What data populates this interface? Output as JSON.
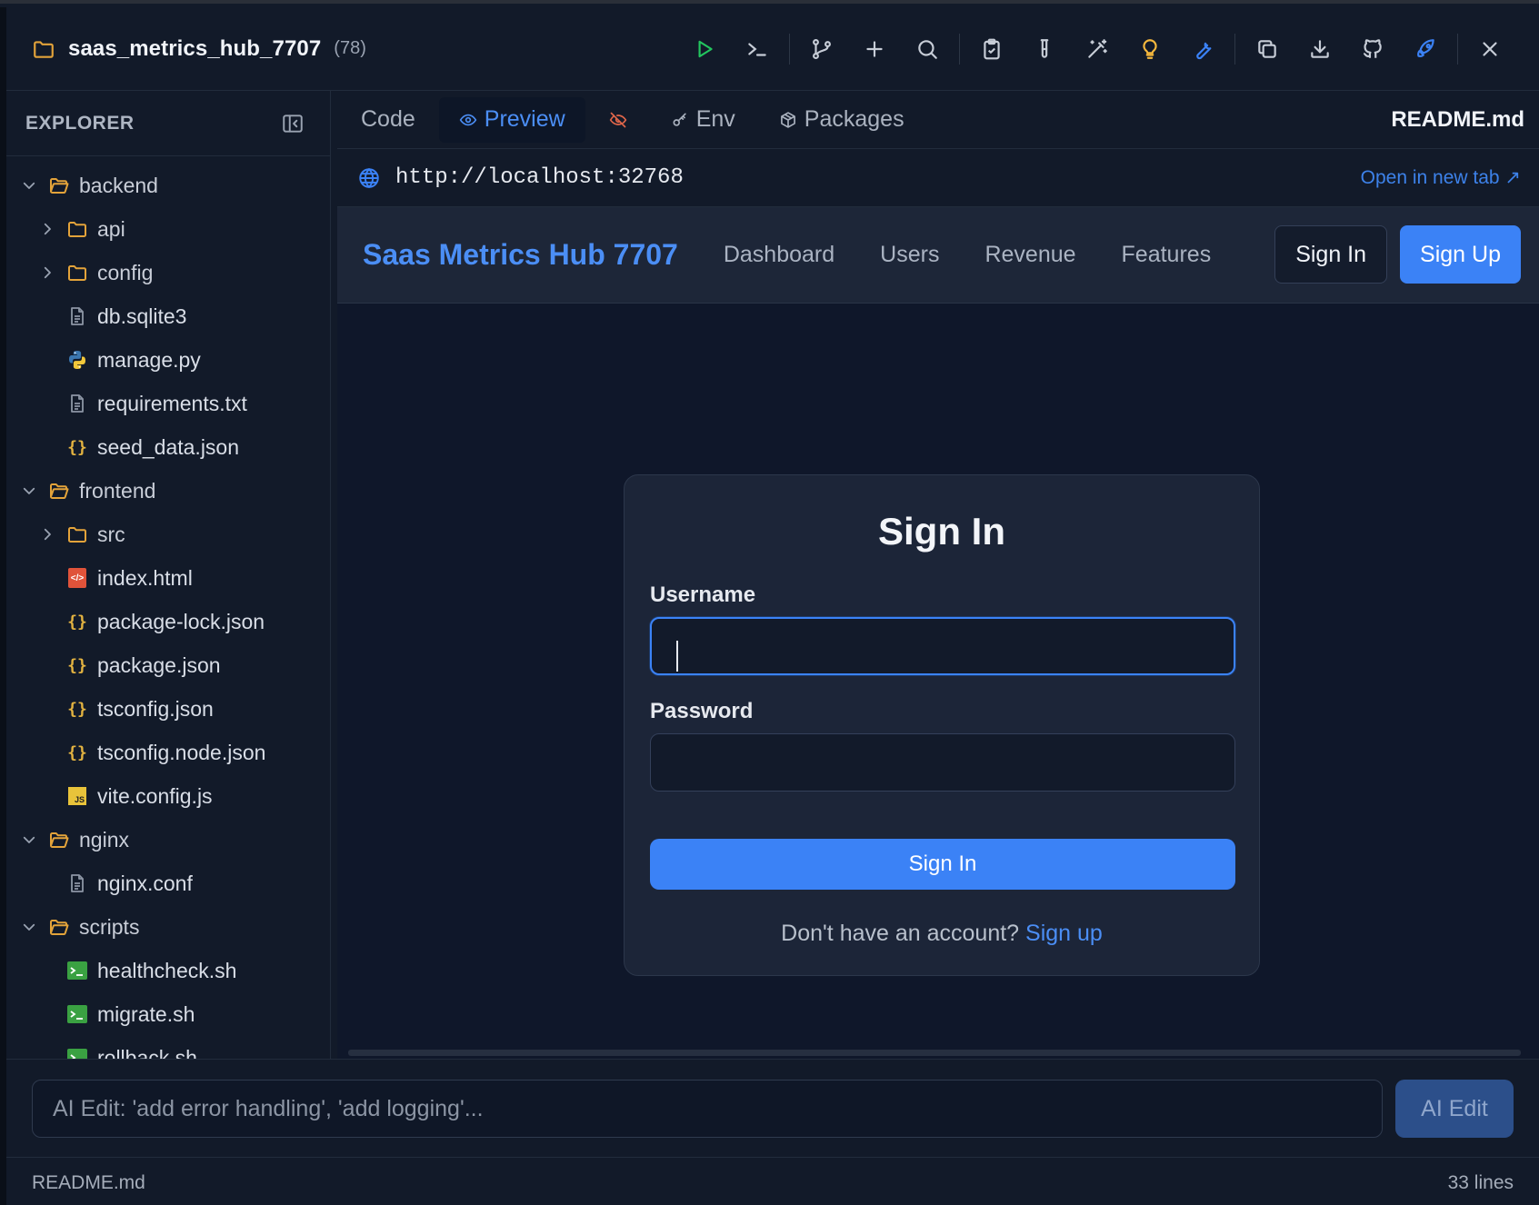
{
  "topbar": {
    "project_name": "saas_metrics_hub_7707",
    "project_count": "(78)",
    "tools": [
      "run-icon",
      "terminal-icon",
      "git-branch-icon",
      "plus-icon",
      "search-icon",
      "clipboard-check-icon",
      "test-tube-icon",
      "magic-wand-icon",
      "lightbulb-icon",
      "wrench-icon",
      "copy-icon",
      "download-icon",
      "github-icon",
      "rocket-icon",
      "close-icon"
    ]
  },
  "explorer": {
    "title": "EXPLORER",
    "rows": [
      {
        "label": "backend",
        "type": "folder",
        "depth": 0,
        "expanded": true
      },
      {
        "label": "api",
        "type": "folder",
        "depth": 1,
        "expanded": false
      },
      {
        "label": "config",
        "type": "folder",
        "depth": 1,
        "expanded": false
      },
      {
        "label": "db.sqlite3",
        "type": "doc",
        "depth": 1
      },
      {
        "label": "manage.py",
        "type": "python",
        "depth": 1
      },
      {
        "label": "requirements.txt",
        "type": "doc",
        "depth": 1
      },
      {
        "label": "seed_data.json",
        "type": "json",
        "depth": 1
      },
      {
        "label": "frontend",
        "type": "folder",
        "depth": 0,
        "expanded": true
      },
      {
        "label": "src",
        "type": "folder",
        "depth": 1,
        "expanded": false
      },
      {
        "label": "index.html",
        "type": "html",
        "depth": 1
      },
      {
        "label": "package-lock.json",
        "type": "json",
        "depth": 1
      },
      {
        "label": "package.json",
        "type": "json",
        "depth": 1
      },
      {
        "label": "tsconfig.json",
        "type": "json",
        "depth": 1
      },
      {
        "label": "tsconfig.node.json",
        "type": "json",
        "depth": 1
      },
      {
        "label": "vite.config.js",
        "type": "js",
        "depth": 1
      },
      {
        "label": "nginx",
        "type": "folder",
        "depth": 0,
        "expanded": true
      },
      {
        "label": "nginx.conf",
        "type": "doc",
        "depth": 1
      },
      {
        "label": "scripts",
        "type": "folder",
        "depth": 0,
        "expanded": true
      },
      {
        "label": "healthcheck.sh",
        "type": "sh",
        "depth": 1
      },
      {
        "label": "migrate.sh",
        "type": "sh",
        "depth": 1
      },
      {
        "label": "rollback.sh",
        "type": "sh",
        "depth": 1
      }
    ]
  },
  "tabs": {
    "code": "Code",
    "preview": "Preview",
    "env": "Env",
    "packages": "Packages",
    "readme": "README.md"
  },
  "urlbar": {
    "url": "http://localhost:32768",
    "open_new": "Open in new tab ↗"
  },
  "site": {
    "brand": "Saas Metrics Hub 7707",
    "nav": [
      "Dashboard",
      "Users",
      "Revenue",
      "Features"
    ],
    "signin": "Sign In",
    "signup": "Sign Up"
  },
  "form": {
    "title": "Sign In",
    "username_label": "Username",
    "username_value": "",
    "password_label": "Password",
    "password_value": "",
    "submit": "Sign In",
    "no_account": "Don't have an account?",
    "signup_link": "Sign up"
  },
  "aibar": {
    "placeholder": "AI Edit: 'add error handling', 'add logging'...",
    "button": "AI Edit"
  },
  "status": {
    "file": "README.md",
    "lines": "33 lines"
  },
  "colors": {
    "accent": "#3b82f6",
    "folder": "#e3a33a",
    "run": "#22c55e",
    "warn": "#f5b83d",
    "rocket": "#3b82f6"
  }
}
